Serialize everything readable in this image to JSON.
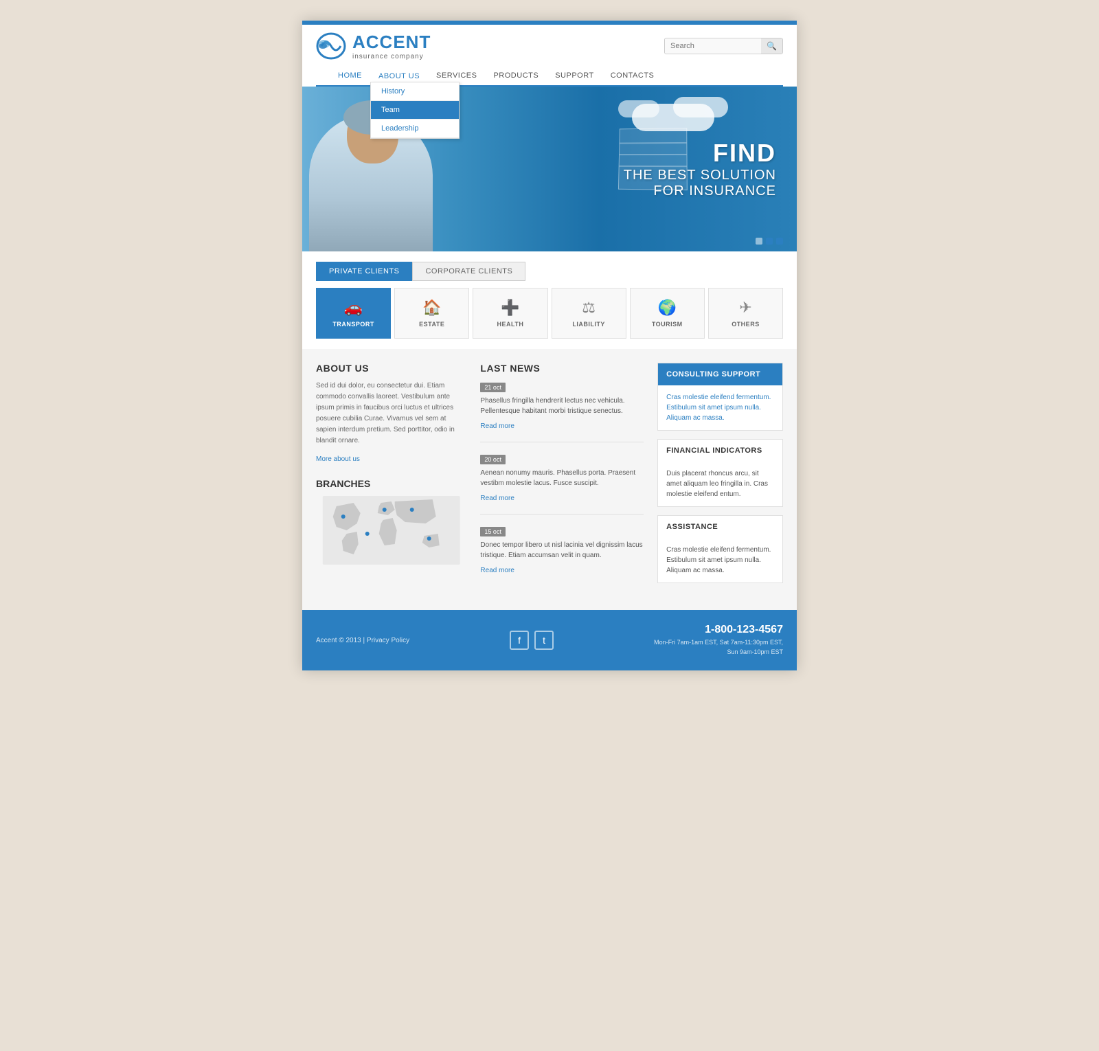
{
  "site": {
    "name": "ACCENT",
    "tagline": "insurance company",
    "top_bar_color": "#2b7fc1"
  },
  "header": {
    "search_placeholder": "Search",
    "search_icon": "🔍"
  },
  "nav": {
    "items": [
      {
        "label": "HOME",
        "active": false
      },
      {
        "label": "ABOUT US",
        "active": true,
        "has_dropdown": true
      },
      {
        "label": "SERVICES",
        "active": false
      },
      {
        "label": "PRODUCTS",
        "active": false
      },
      {
        "label": "SUPPORT",
        "active": false
      },
      {
        "label": "CONTACTS",
        "active": false
      }
    ],
    "dropdown": {
      "items": [
        {
          "label": "History",
          "selected": false
        },
        {
          "label": "Team",
          "selected": true
        },
        {
          "label": "Leadership",
          "selected": false
        }
      ]
    }
  },
  "hero": {
    "line1": "FIND",
    "line2": "THE BEST SOLUTION",
    "line3": "FOR INSURANCE",
    "dots": [
      false,
      true,
      true
    ]
  },
  "tabs": {
    "items": [
      {
        "label": "PRIVATE CLIENTS",
        "active": true
      },
      {
        "label": "CORPORATE CLIENTS",
        "active": false
      }
    ]
  },
  "categories": [
    {
      "label": "TRANSPORT",
      "icon": "🚗",
      "active": true
    },
    {
      "label": "ESTATE",
      "icon": "🏠",
      "active": false
    },
    {
      "label": "HEALTH",
      "icon": "➕",
      "active": false
    },
    {
      "label": "LIABILITY",
      "icon": "⚖",
      "active": false
    },
    {
      "label": "TOURISM",
      "icon": "🌍",
      "active": false
    },
    {
      "label": "OTHERS",
      "icon": "✈",
      "active": false
    }
  ],
  "about": {
    "title": "ABOUT US",
    "body": "Sed id dui dolor, eu consectetur dui. Etiam commodo convallis laoreet. Vestibulum ante ipsum primis in faucibus orci luctus et ultrices posuere cubilia Curae. Vivamus vel sem at sapien interdum pretium. Sed porttitor, odio in blandit ornare.",
    "link": "More about us"
  },
  "branches": {
    "title": "BRANCHES"
  },
  "news": {
    "title": "LAST NEWS",
    "items": [
      {
        "date": "21 oct",
        "text": "Phasellus fringilla hendrerit lectus nec vehicula. Pellentesque habitant morbi tristique senectus.",
        "link": "Read more"
      },
      {
        "date": "20 oct",
        "text": "Aenean nonumy mauris. Phasellus porta. Praesent vestibm molestie lacus. Fusce suscipit.",
        "link": "Read more"
      },
      {
        "date": "15 oct",
        "text": "Donec tempor libero ut nisl lacinia vel dignissim lacus tristique. Etiam accumsan velit in quam.",
        "link": "Read more"
      }
    ]
  },
  "widgets": {
    "consulting": {
      "header": "CONSULTING SUPPORT",
      "text": "Cras molestie eleifend fermentum. Estibulum sit amet ipsum nulla. Aliquam ac massa."
    },
    "financial": {
      "header": "FINANCIAL INDICATORS",
      "text": "Duis placerat rhoncus arcu, sit amet aliquam leo fringilla in. Cras molestie eleifend entum."
    },
    "assistance": {
      "header": "ASSISTANCE",
      "text": "Cras molestie eleifend fermentum. Estibulum sit amet ipsum nulla.  Aliquam ac massa."
    }
  },
  "footer": {
    "copy": "Accent © 2013 | Privacy Policy",
    "social": [
      "f",
      "t"
    ],
    "phone": "1-800-123-4567",
    "hours_line1": "Mon-Fri 7am-1am EST, Sat 7am-11:30pm EST,",
    "hours_line2": "Sun 9am-10pm EST"
  }
}
